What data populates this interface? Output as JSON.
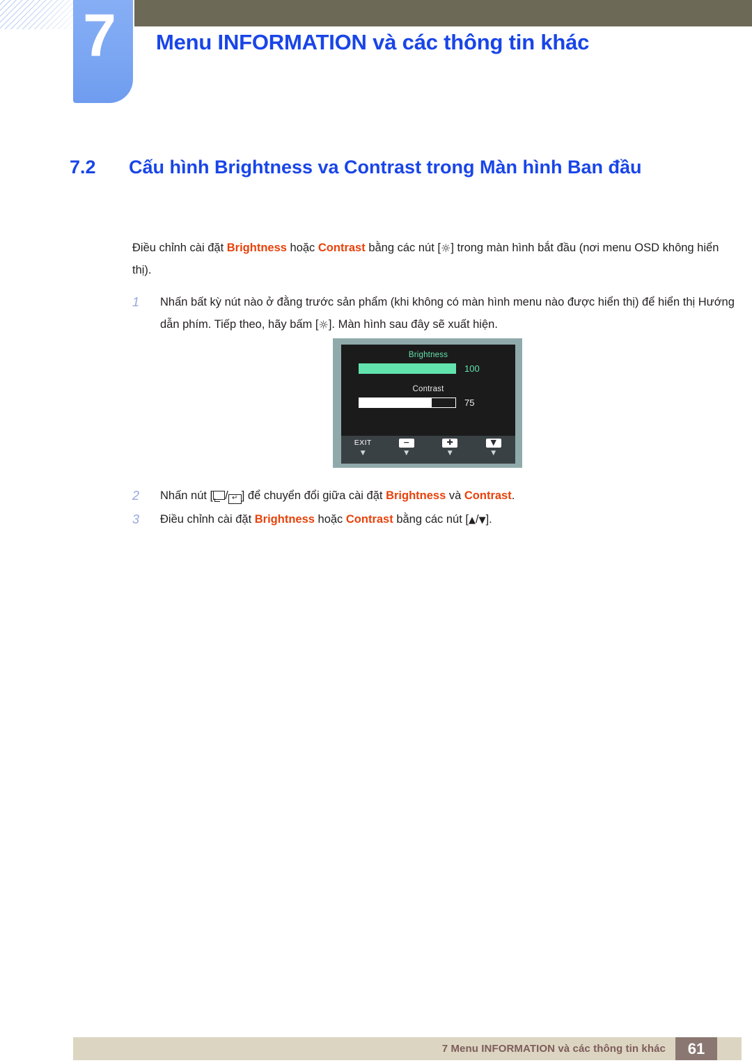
{
  "header": {
    "chapter_number": "7",
    "chapter_title": "Menu INFORMATION và các thông tin khác",
    "bar_color": "#6c6a57",
    "tab_color": "#7ba6f2",
    "title_color": "#1945e8"
  },
  "section": {
    "number": "7.2",
    "title": "Cấu hình Brightness  va  Contrast trong Màn hình Ban đầu"
  },
  "intro": {
    "part1": "Điều chỉnh cài đặt ",
    "term1": "Brightness",
    "part2": " hoặc ",
    "term2": "Contrast",
    "part3": " bằng các nút [",
    "icon": "☼",
    "part4": "] trong màn hình bắt đầu (nơi menu OSD không hiển thị)."
  },
  "steps": [
    {
      "number": "1",
      "part1": "Nhấn bất kỳ nút nào ở đằng trước sản phẩm (khi không có màn hình menu nào được hiển thị) để hiển thị Hướng dẫn phím. Tiếp theo, hãy bấm [",
      "icon": "☼",
      "part2": "]. Màn hình sau đây sẽ xuất hiện."
    },
    {
      "number": "2",
      "part1": "Nhấn nút [",
      "icon_box": "square-key-icon",
      "slash": "/",
      "icon_enter": "enter-key-icon",
      "part2": "] để chuyển đổi giữa cài đặt ",
      "term1": "Brightness",
      "part3": " và ",
      "term2": "Contrast",
      "part4": "."
    },
    {
      "number": "3",
      "part1": "Điều chỉnh cài đặt ",
      "term1": "Brightness",
      "part2": " hoặc ",
      "term2": "Contrast",
      "part3": " bằng các nút [",
      "icon_up": "▲",
      "slash": "/",
      "icon_down": "▼",
      "part4": "]."
    }
  ],
  "osd": {
    "brightness_label": "Brightness",
    "brightness_value": "100",
    "brightness_percent": 100,
    "brightness_color": "#62e3ad",
    "contrast_label": "Contrast",
    "contrast_value": "75",
    "contrast_percent": 75,
    "contrast_color": "#ffffff",
    "buttons": [
      {
        "name": "exit",
        "label": "EXIT",
        "caret": "▼"
      },
      {
        "name": "minus",
        "label": "−",
        "caret": "▼"
      },
      {
        "name": "plus",
        "label": "✚",
        "caret": "▼"
      },
      {
        "name": "down",
        "label": "▼",
        "caret": "▼"
      }
    ],
    "bezel_color": "#90aaab",
    "screen_color": "#1b1b1b",
    "footer_color": "#3a4145"
  },
  "footer": {
    "text": "7 Menu INFORMATION và các thông tin khác",
    "page": "61",
    "bar_color": "#dcd5c1",
    "text_color": "#7d5c5c",
    "page_box_color": "#8b7771"
  }
}
